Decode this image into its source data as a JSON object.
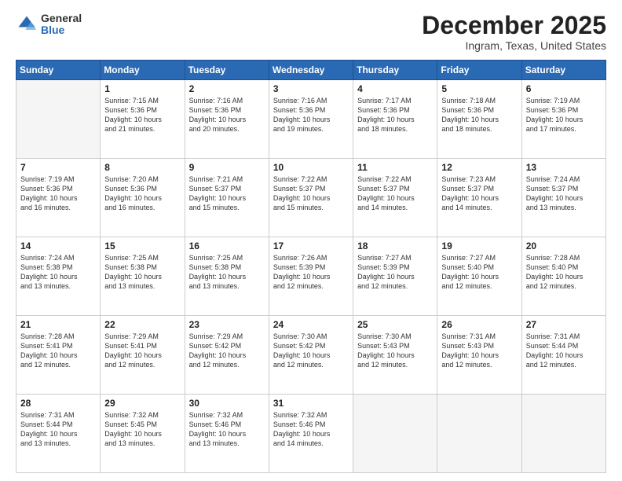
{
  "logo": {
    "general": "General",
    "blue": "Blue"
  },
  "title": {
    "month": "December 2025",
    "location": "Ingram, Texas, United States"
  },
  "days_of_week": [
    "Sunday",
    "Monday",
    "Tuesday",
    "Wednesday",
    "Thursday",
    "Friday",
    "Saturday"
  ],
  "weeks": [
    [
      {
        "day": "",
        "info": ""
      },
      {
        "day": "1",
        "info": "Sunrise: 7:15 AM\nSunset: 5:36 PM\nDaylight: 10 hours\nand 21 minutes."
      },
      {
        "day": "2",
        "info": "Sunrise: 7:16 AM\nSunset: 5:36 PM\nDaylight: 10 hours\nand 20 minutes."
      },
      {
        "day": "3",
        "info": "Sunrise: 7:16 AM\nSunset: 5:36 PM\nDaylight: 10 hours\nand 19 minutes."
      },
      {
        "day": "4",
        "info": "Sunrise: 7:17 AM\nSunset: 5:36 PM\nDaylight: 10 hours\nand 18 minutes."
      },
      {
        "day": "5",
        "info": "Sunrise: 7:18 AM\nSunset: 5:36 PM\nDaylight: 10 hours\nand 18 minutes."
      },
      {
        "day": "6",
        "info": "Sunrise: 7:19 AM\nSunset: 5:36 PM\nDaylight: 10 hours\nand 17 minutes."
      }
    ],
    [
      {
        "day": "7",
        "info": "Sunrise: 7:19 AM\nSunset: 5:36 PM\nDaylight: 10 hours\nand 16 minutes."
      },
      {
        "day": "8",
        "info": "Sunrise: 7:20 AM\nSunset: 5:36 PM\nDaylight: 10 hours\nand 16 minutes."
      },
      {
        "day": "9",
        "info": "Sunrise: 7:21 AM\nSunset: 5:37 PM\nDaylight: 10 hours\nand 15 minutes."
      },
      {
        "day": "10",
        "info": "Sunrise: 7:22 AM\nSunset: 5:37 PM\nDaylight: 10 hours\nand 15 minutes."
      },
      {
        "day": "11",
        "info": "Sunrise: 7:22 AM\nSunset: 5:37 PM\nDaylight: 10 hours\nand 14 minutes."
      },
      {
        "day": "12",
        "info": "Sunrise: 7:23 AM\nSunset: 5:37 PM\nDaylight: 10 hours\nand 14 minutes."
      },
      {
        "day": "13",
        "info": "Sunrise: 7:24 AM\nSunset: 5:37 PM\nDaylight: 10 hours\nand 13 minutes."
      }
    ],
    [
      {
        "day": "14",
        "info": "Sunrise: 7:24 AM\nSunset: 5:38 PM\nDaylight: 10 hours\nand 13 minutes."
      },
      {
        "day": "15",
        "info": "Sunrise: 7:25 AM\nSunset: 5:38 PM\nDaylight: 10 hours\nand 13 minutes."
      },
      {
        "day": "16",
        "info": "Sunrise: 7:25 AM\nSunset: 5:38 PM\nDaylight: 10 hours\nand 13 minutes."
      },
      {
        "day": "17",
        "info": "Sunrise: 7:26 AM\nSunset: 5:39 PM\nDaylight: 10 hours\nand 12 minutes."
      },
      {
        "day": "18",
        "info": "Sunrise: 7:27 AM\nSunset: 5:39 PM\nDaylight: 10 hours\nand 12 minutes."
      },
      {
        "day": "19",
        "info": "Sunrise: 7:27 AM\nSunset: 5:40 PM\nDaylight: 10 hours\nand 12 minutes."
      },
      {
        "day": "20",
        "info": "Sunrise: 7:28 AM\nSunset: 5:40 PM\nDaylight: 10 hours\nand 12 minutes."
      }
    ],
    [
      {
        "day": "21",
        "info": "Sunrise: 7:28 AM\nSunset: 5:41 PM\nDaylight: 10 hours\nand 12 minutes."
      },
      {
        "day": "22",
        "info": "Sunrise: 7:29 AM\nSunset: 5:41 PM\nDaylight: 10 hours\nand 12 minutes."
      },
      {
        "day": "23",
        "info": "Sunrise: 7:29 AM\nSunset: 5:42 PM\nDaylight: 10 hours\nand 12 minutes."
      },
      {
        "day": "24",
        "info": "Sunrise: 7:30 AM\nSunset: 5:42 PM\nDaylight: 10 hours\nand 12 minutes."
      },
      {
        "day": "25",
        "info": "Sunrise: 7:30 AM\nSunset: 5:43 PM\nDaylight: 10 hours\nand 12 minutes."
      },
      {
        "day": "26",
        "info": "Sunrise: 7:31 AM\nSunset: 5:43 PM\nDaylight: 10 hours\nand 12 minutes."
      },
      {
        "day": "27",
        "info": "Sunrise: 7:31 AM\nSunset: 5:44 PM\nDaylight: 10 hours\nand 12 minutes."
      }
    ],
    [
      {
        "day": "28",
        "info": "Sunrise: 7:31 AM\nSunset: 5:44 PM\nDaylight: 10 hours\nand 13 minutes."
      },
      {
        "day": "29",
        "info": "Sunrise: 7:32 AM\nSunset: 5:45 PM\nDaylight: 10 hours\nand 13 minutes."
      },
      {
        "day": "30",
        "info": "Sunrise: 7:32 AM\nSunset: 5:46 PM\nDaylight: 10 hours\nand 13 minutes."
      },
      {
        "day": "31",
        "info": "Sunrise: 7:32 AM\nSunset: 5:46 PM\nDaylight: 10 hours\nand 14 minutes."
      },
      {
        "day": "",
        "info": ""
      },
      {
        "day": "",
        "info": ""
      },
      {
        "day": "",
        "info": ""
      }
    ]
  ]
}
